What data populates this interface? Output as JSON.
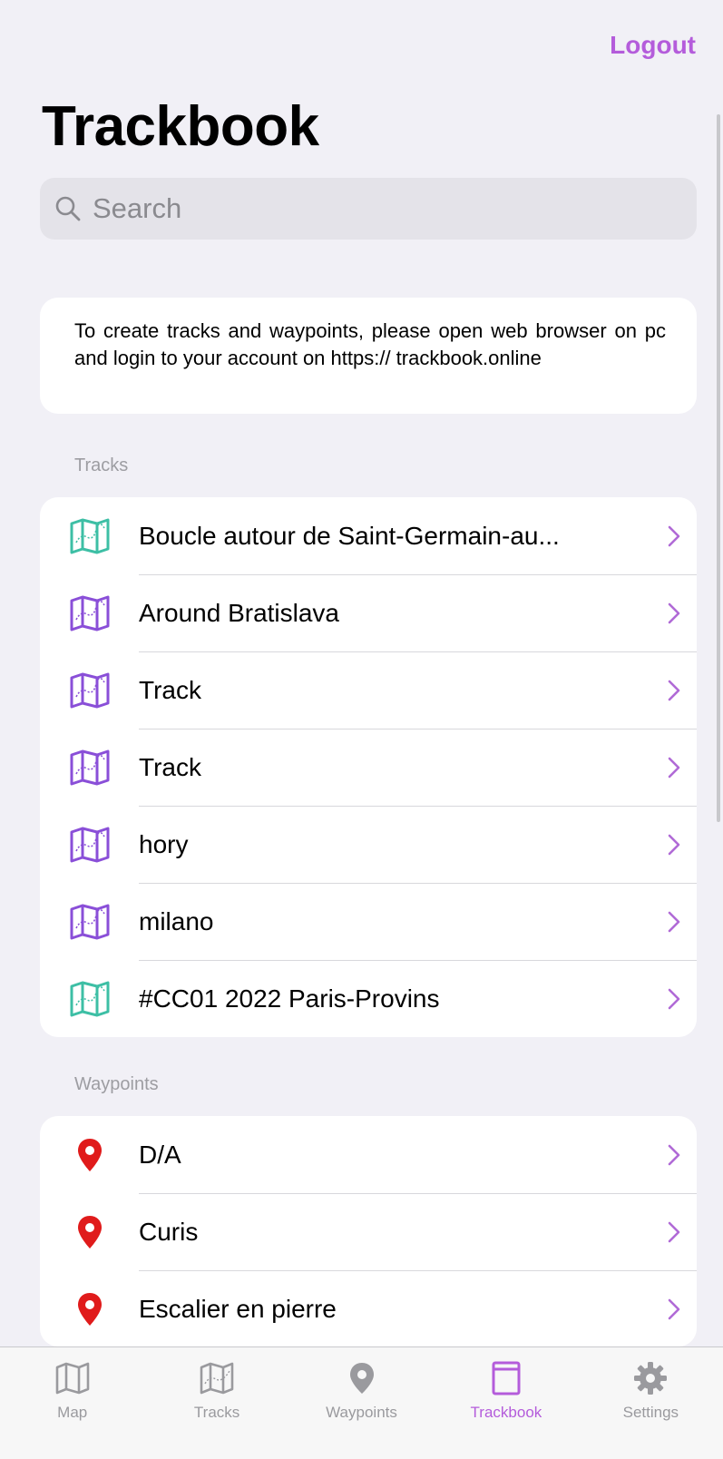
{
  "header": {
    "logout_label": "Logout",
    "title": "Trackbook"
  },
  "search": {
    "placeholder": "Search",
    "icon": "search-icon"
  },
  "info": {
    "text": "To create tracks and waypoints, please open web browser on pc and login to your account on https:// trackbook.online"
  },
  "tracks": {
    "section_label": "Tracks",
    "items": [
      {
        "label": "Boucle autour de Saint-Germain-au...",
        "icon_color": "#3dbfa5"
      },
      {
        "label": "Around Bratislava",
        "icon_color": "#8a4fd8"
      },
      {
        "label": "Track",
        "icon_color": "#8a4fd8"
      },
      {
        "label": "Track",
        "icon_color": "#8a4fd8"
      },
      {
        "label": "hory",
        "icon_color": "#8a4fd8"
      },
      {
        "label": "milano",
        "icon_color": "#8a4fd8"
      },
      {
        "label": "#CC01 2022 Paris-Provins",
        "icon_color": "#3dbfa5"
      }
    ]
  },
  "waypoints": {
    "section_label": "Waypoints",
    "items": [
      {
        "label": "D/A",
        "icon_color": "#e01b1b"
      },
      {
        "label": "Curis",
        "icon_color": "#e01b1b"
      },
      {
        "label": "Escalier en pierre",
        "icon_color": "#e01b1b"
      }
    ]
  },
  "tabbar": {
    "tabs": [
      {
        "label": "Map",
        "icon": "map-icon",
        "active": false
      },
      {
        "label": "Tracks",
        "icon": "track-map-icon",
        "active": false
      },
      {
        "label": "Waypoints",
        "icon": "pin-icon",
        "active": false
      },
      {
        "label": "Trackbook",
        "icon": "book-icon",
        "active": true
      },
      {
        "label": "Settings",
        "icon": "gear-icon",
        "active": false
      }
    ]
  },
  "colors": {
    "accent": "#b45cdb",
    "chevron": "#b06ad6",
    "background": "#f1f0f6"
  }
}
